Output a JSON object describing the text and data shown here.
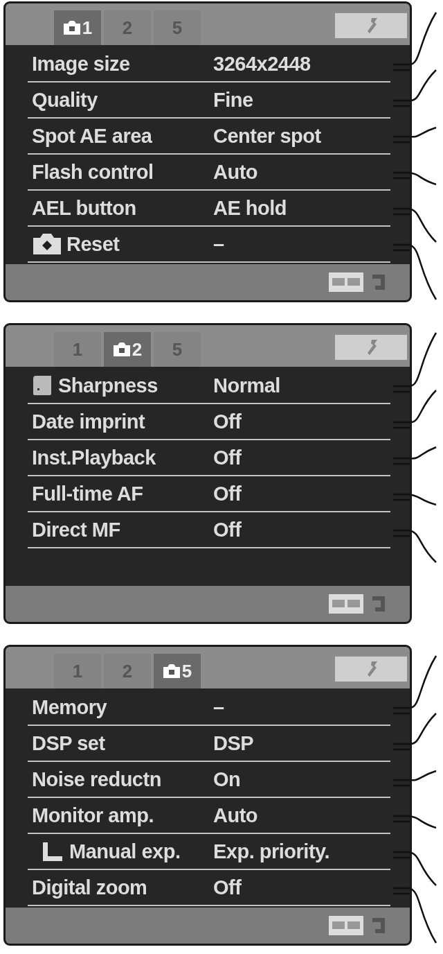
{
  "screens": [
    {
      "tabs": [
        {
          "label": "1",
          "selected": true
        },
        {
          "label": "2",
          "selected": false
        },
        {
          "label": "5",
          "selected": false
        }
      ],
      "items": [
        {
          "kind": "plain",
          "label": "Image size",
          "value": "3264x2448"
        },
        {
          "kind": "plain",
          "label": "Quality",
          "value": "Fine"
        },
        {
          "kind": "plain",
          "label": "Spot AE area",
          "value": "Center spot"
        },
        {
          "kind": "plain",
          "label": "Flash control",
          "value": "Auto"
        },
        {
          "kind": "plain",
          "label": "AEL button",
          "value": "AE hold"
        },
        {
          "kind": "camera",
          "label": "Reset",
          "value": "–"
        }
      ]
    },
    {
      "tabs": [
        {
          "label": "1",
          "selected": false
        },
        {
          "label": "2",
          "selected": true
        },
        {
          "label": "5",
          "selected": false
        }
      ],
      "items": [
        {
          "kind": "square",
          "label": "Sharpness",
          "value": "Normal"
        },
        {
          "kind": "plain",
          "label": "Date imprint",
          "value": "Off"
        },
        {
          "kind": "plain",
          "label": "Inst.Playback",
          "value": "Off"
        },
        {
          "kind": "plain",
          "label": "Full-time AF",
          "value": "Off"
        },
        {
          "kind": "plain",
          "label": "Direct MF",
          "value": "Off"
        }
      ]
    },
    {
      "tabs": [
        {
          "label": "1",
          "selected": false
        },
        {
          "label": "2",
          "selected": false
        },
        {
          "label": "5",
          "selected": true
        }
      ],
      "items": [
        {
          "kind": "plain",
          "label": "Memory",
          "value": "–"
        },
        {
          "kind": "plain",
          "label": "DSP set",
          "value": "DSP"
        },
        {
          "kind": "plain",
          "label": "Noise reductn",
          "value": "On"
        },
        {
          "kind": "plain",
          "label": "Monitor amp.",
          "value": "Auto"
        },
        {
          "kind": "sub",
          "label": "Manual exp.",
          "value": "Exp. priority."
        },
        {
          "kind": "plain",
          "label": "Digital zoom",
          "value": "Off"
        }
      ]
    }
  ]
}
